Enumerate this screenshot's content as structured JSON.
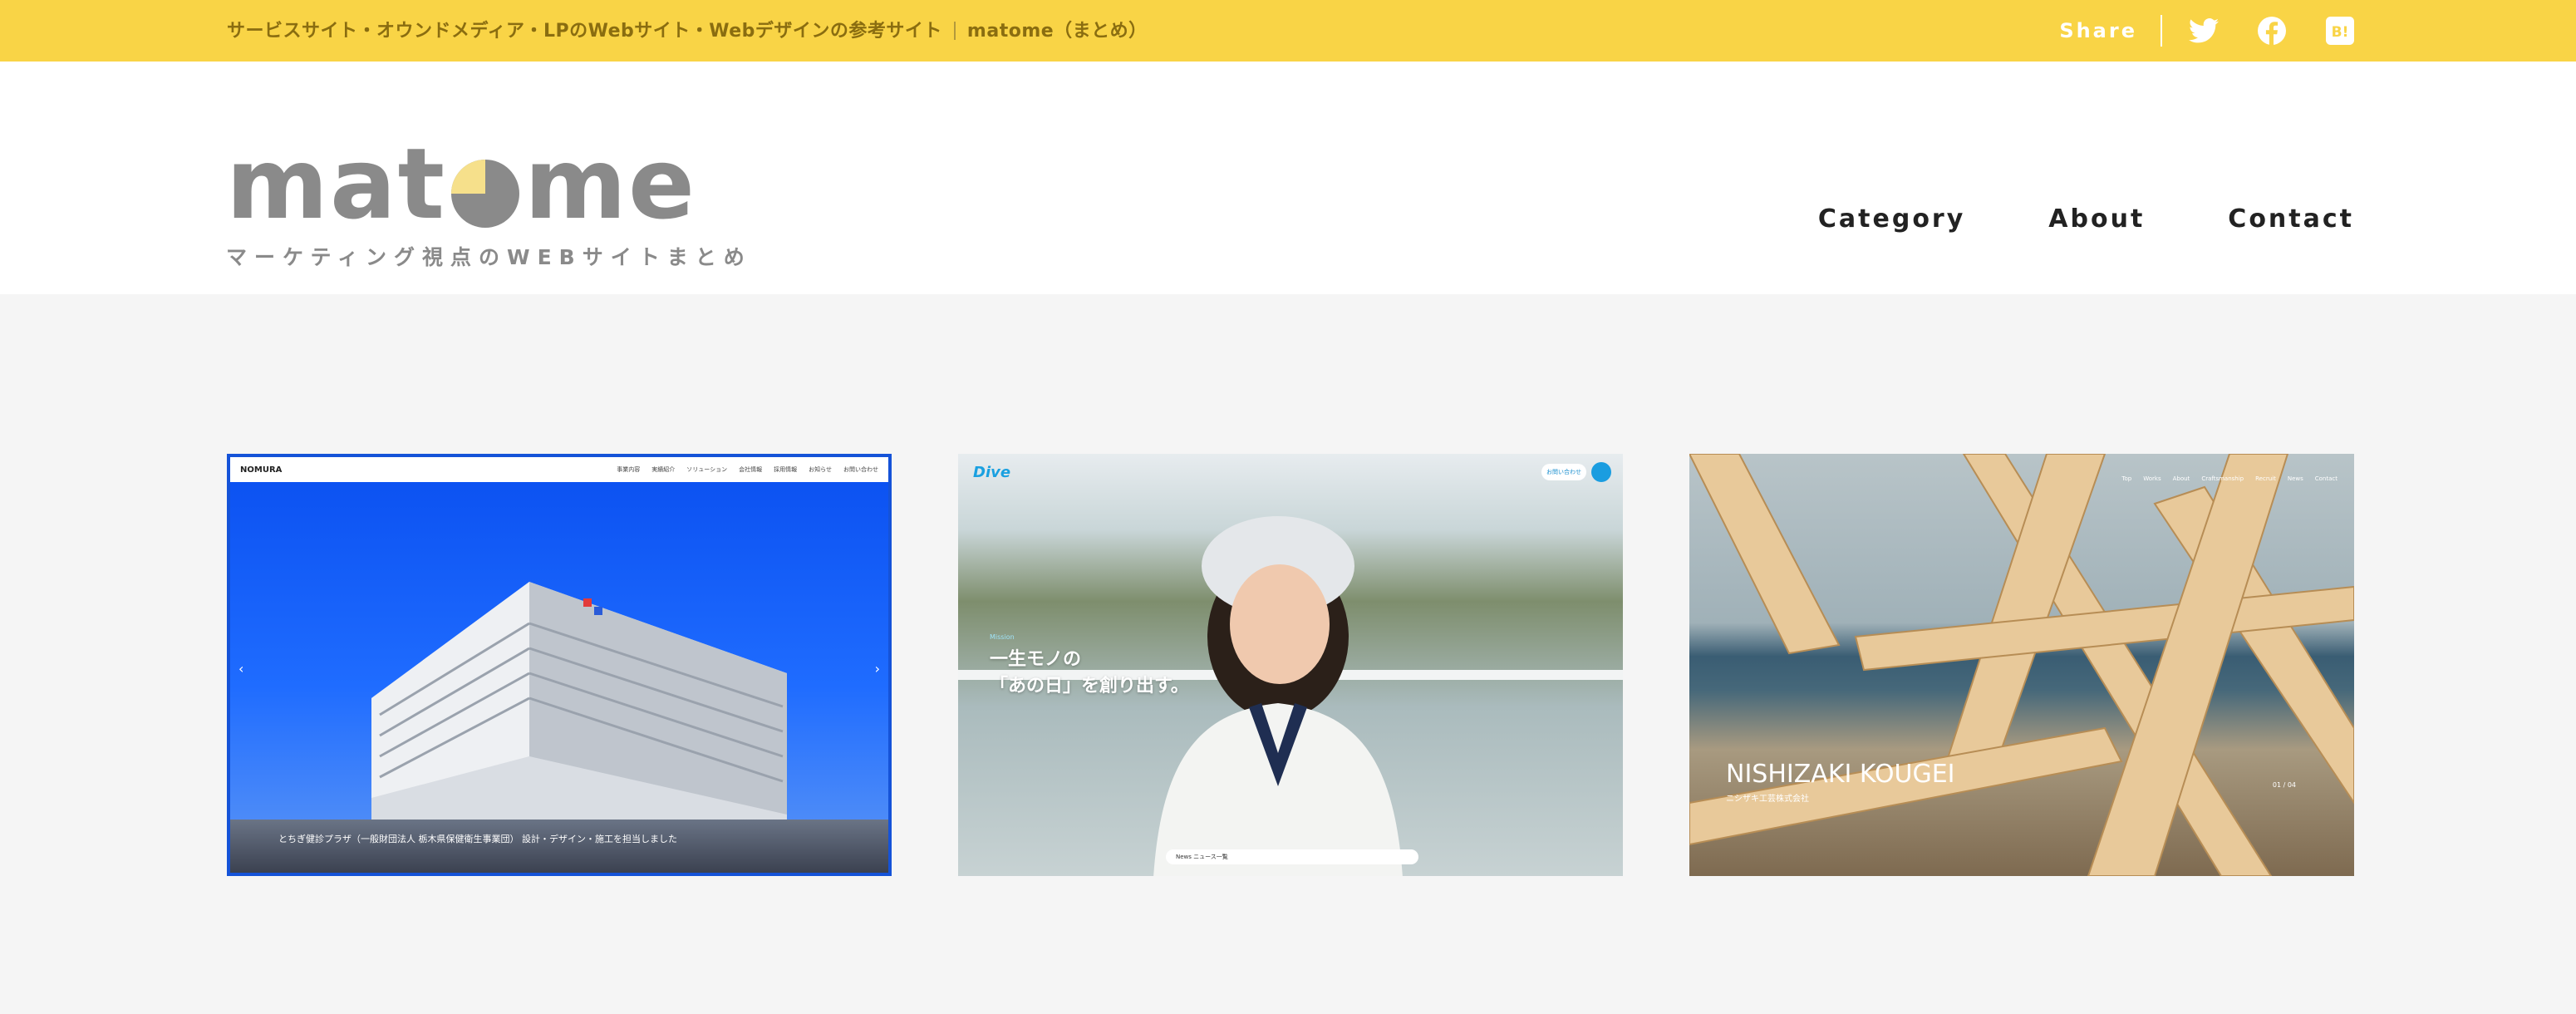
{
  "topbar": {
    "tagline": "サービスサイト・オウンドメディア・LPのWebサイト・Webデザインの参考サイト",
    "site_name": "matome（まとめ）",
    "share_label": "Share",
    "share_icons": [
      "twitter-icon",
      "facebook-icon",
      "hatena-bookmark-icon"
    ],
    "hatena_glyph": "B!"
  },
  "logo": {
    "word_left": "mat",
    "word_right": "me",
    "tagline": "マーケティング視点のWEBサイトまとめ"
  },
  "nav": {
    "items": [
      "Category",
      "About",
      "Contact"
    ]
  },
  "cards": [
    {
      "brand": "NOMURA",
      "menu": [
        "事業内容",
        "実績紹介",
        "ソリューション",
        "会社情報",
        "採用情報",
        "お知らせ",
        "お問い合わせ"
      ],
      "caption": "とちぎ健診プラザ（一般財団法人 栃木県保健衛生事業団） 設計・デザイン・施工を担当しました",
      "arrow_left": "‹",
      "arrow_right": "›"
    },
    {
      "brand": "Dive",
      "tag": "Mission",
      "copy_line1": "一生モノの",
      "copy_line2": "「あの日」を創り出す。",
      "pill": "お問い合わせ",
      "news": "News ニュース一覧"
    },
    {
      "menu": [
        "Top",
        "Works",
        "About",
        "Craftsmanship",
        "Recruit",
        "News",
        "Contact"
      ],
      "title": "NISHIZAKI KOUGEI",
      "subtitle": "ニシザキ工芸株式会社",
      "counter": "01 / 04"
    }
  ],
  "colors": {
    "topbar_bg": "#f9d446",
    "logo_gray": "#8a8a8a",
    "logo_accent": "#f6e08b",
    "page_bg": "#f5f5f5"
  }
}
